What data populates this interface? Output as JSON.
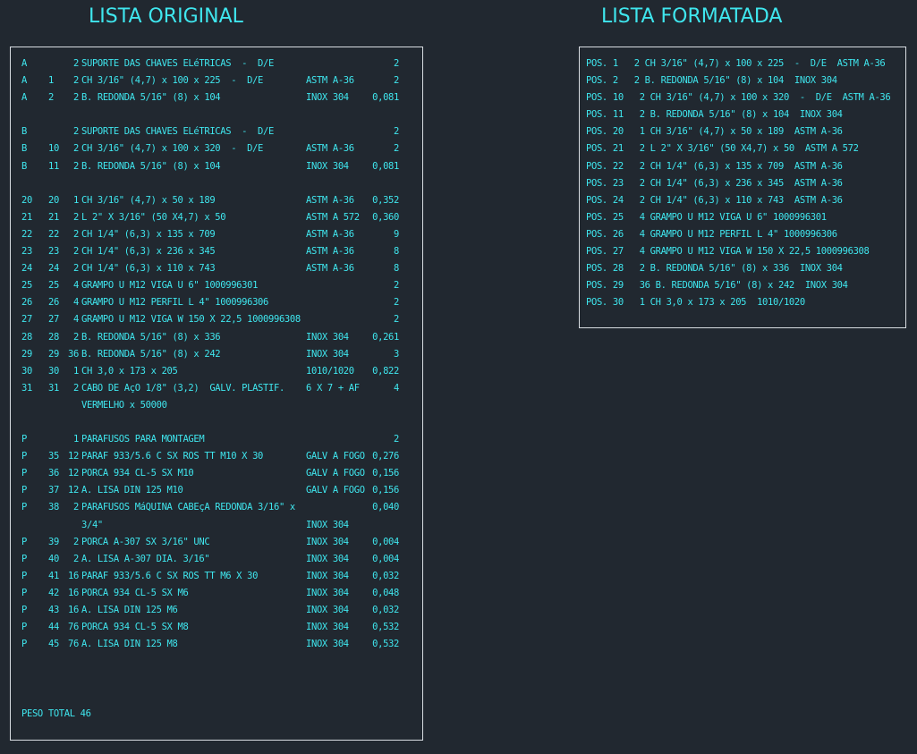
{
  "titles": {
    "left": "LISTA ORIGINAL",
    "right": "LISTA FORMATADA"
  },
  "original": {
    "rows": [
      {
        "group": "A",
        "pos": "",
        "qty": "2",
        "desc": "SUPORTE DAS CHAVES ELéTRICAS  -  D/E",
        "mat": "",
        "wt": "2"
      },
      {
        "group": "A",
        "pos": "1",
        "qty": "2",
        "desc": "CH 3/16\" (4,7) x 100 x 225  -  D/E",
        "mat": "ASTM A-36",
        "wt": "2"
      },
      {
        "group": "A",
        "pos": "2",
        "qty": "2",
        "desc": "B. REDONDA 5/16\" (8) x 104",
        "mat": "INOX 304",
        "wt": "0,081"
      },
      {
        "group": "",
        "pos": "",
        "qty": "",
        "desc": "",
        "mat": "",
        "wt": ""
      },
      {
        "group": "B",
        "pos": "",
        "qty": "2",
        "desc": "SUPORTE DAS CHAVES ELéTRICAS  -  D/E",
        "mat": "",
        "wt": "2"
      },
      {
        "group": "B",
        "pos": "10",
        "qty": "2",
        "desc": "CH 3/16\" (4,7) x 100 x 320  -  D/E",
        "mat": "ASTM A-36",
        "wt": "2"
      },
      {
        "group": "B",
        "pos": "11",
        "qty": "2",
        "desc": "B. REDONDA 5/16\" (8) x 104",
        "mat": "INOX 304",
        "wt": "0,081"
      },
      {
        "group": "",
        "pos": "",
        "qty": "",
        "desc": "",
        "mat": "",
        "wt": ""
      },
      {
        "group": "20",
        "pos": "20",
        "qty": "1",
        "desc": "CH 3/16\" (4,7) x 50 x 189",
        "mat": "ASTM A-36",
        "wt": "0,352"
      },
      {
        "group": "21",
        "pos": "21",
        "qty": "2",
        "desc": "L 2\" X 3/16\" (50 X4,7) x 50",
        "mat": "ASTM A 572",
        "wt": "0,360"
      },
      {
        "group": "22",
        "pos": "22",
        "qty": "2",
        "desc": "CH 1/4\" (6,3) x 135 x 709",
        "mat": "ASTM A-36",
        "wt": "9"
      },
      {
        "group": "23",
        "pos": "23",
        "qty": "2",
        "desc": "CH 1/4\" (6,3) x 236 x 345",
        "mat": "ASTM A-36",
        "wt": "8"
      },
      {
        "group": "24",
        "pos": "24",
        "qty": "2",
        "desc": "CH 1/4\" (6,3) x 110 x 743",
        "mat": "ASTM A-36",
        "wt": "8"
      },
      {
        "group": "25",
        "pos": "25",
        "qty": "4",
        "desc": "GRAMPO U M12 VIGA U 6\" 1000996301",
        "mat": "",
        "wt": "2"
      },
      {
        "group": "26",
        "pos": "26",
        "qty": "4",
        "desc": "GRAMPO U M12 PERFIL L 4\" 1000996306",
        "mat": "",
        "wt": "2"
      },
      {
        "group": "27",
        "pos": "27",
        "qty": "4",
        "desc": "GRAMPO U M12 VIGA W 150 X 22,5 1000996308",
        "mat": "",
        "wt": "2"
      },
      {
        "group": "28",
        "pos": "28",
        "qty": "2",
        "desc": "B. REDONDA 5/16\" (8) x 336",
        "mat": "INOX 304",
        "wt": "0,261"
      },
      {
        "group": "29",
        "pos": "29",
        "qty": "36",
        "desc": "B. REDONDA 5/16\" (8) x 242",
        "mat": "INOX 304",
        "wt": "3"
      },
      {
        "group": "30",
        "pos": "30",
        "qty": "1",
        "desc": "CH 3,0 x 173 x 205",
        "mat": "1010/1020",
        "wt": "0,822"
      },
      {
        "group": "31",
        "pos": "31",
        "qty": "2",
        "desc": "CABO DE AçO 1/8\" (3,2)  GALV. PLASTIF.",
        "mat": "6 X 7 + AF",
        "wt": "4"
      },
      {
        "group": "",
        "pos": "",
        "qty": "",
        "desc": "VERMELHO x 50000",
        "mat": "",
        "wt": ""
      },
      {
        "group": "",
        "pos": "",
        "qty": "",
        "desc": "",
        "mat": "",
        "wt": ""
      },
      {
        "group": "P",
        "pos": "",
        "qty": "1",
        "desc": "PARAFUSOS PARA MONTAGEM",
        "mat": "",
        "wt": "2"
      },
      {
        "group": "P",
        "pos": "35",
        "qty": "12",
        "desc": "PARAF 933/5.6 C SX ROS TT M10 X 30",
        "mat": "GALV A FOGO",
        "wt": "0,276"
      },
      {
        "group": "P",
        "pos": "36",
        "qty": "12",
        "desc": "PORCA 934 CL-5 SX M10",
        "mat": "GALV A FOGO",
        "wt": "0,156"
      },
      {
        "group": "P",
        "pos": "37",
        "qty": "12",
        "desc": "A. LISA DIN 125 M10",
        "mat": "GALV A FOGO",
        "wt": "0,156"
      },
      {
        "group": "P",
        "pos": "38",
        "qty": "2",
        "desc": "PARAFUSOS MáQUINA CABEçA REDONDA 3/16\" x",
        "mat": "",
        "wt": "0,040"
      },
      {
        "group": "",
        "pos": "",
        "qty": "",
        "desc": "3/4\"",
        "mat": "INOX 304",
        "wt": ""
      },
      {
        "group": "P",
        "pos": "39",
        "qty": "2",
        "desc": "PORCA A-307 SX 3/16\" UNC",
        "mat": "INOX 304",
        "wt": "0,004"
      },
      {
        "group": "P",
        "pos": "40",
        "qty": "2",
        "desc": "A. LISA A-307 DIA. 3/16\"",
        "mat": "INOX 304",
        "wt": "0,004"
      },
      {
        "group": "P",
        "pos": "41",
        "qty": "16",
        "desc": "PARAF 933/5.6 C SX ROS TT M6 X 30",
        "mat": "INOX 304",
        "wt": "0,032"
      },
      {
        "group": "P",
        "pos": "42",
        "qty": "16",
        "desc": "PORCA 934 CL-5 SX M6",
        "mat": "INOX 304",
        "wt": "0,048"
      },
      {
        "group": "P",
        "pos": "43",
        "qty": "16",
        "desc": "A. LISA DIN 125 M6",
        "mat": "INOX 304",
        "wt": "0,032"
      },
      {
        "group": "P",
        "pos": "44",
        "qty": "76",
        "desc": "PORCA 934 CL-5 SX M8",
        "mat": "INOX 304",
        "wt": "0,532"
      },
      {
        "group": "P",
        "pos": "45",
        "qty": "76",
        "desc": "A. LISA DIN 125 M8",
        "mat": "INOX 304",
        "wt": "0,532"
      }
    ],
    "total": "PESO TOTAL 46"
  },
  "formatted": {
    "rows": [
      "POS. 1   2 CH 3/16\" (4,7) x 100 x 225  -  D/E  ASTM A-36",
      "POS. 2   2 B. REDONDA 5/16\" (8) x 104  INOX 304",
      "POS. 10   2 CH 3/16\" (4,7) x 100 x 320  -  D/E  ASTM A-36",
      "POS. 11   2 B. REDONDA 5/16\" (8) x 104  INOX 304",
      "POS. 20   1 CH 3/16\" (4,7) x 50 x 189  ASTM A-36",
      "POS. 21   2 L 2\" X 3/16\" (50 X4,7) x 50  ASTM A 572",
      "POS. 22   2 CH 1/4\" (6,3) x 135 x 709  ASTM A-36",
      "POS. 23   2 CH 1/4\" (6,3) x 236 x 345  ASTM A-36",
      "POS. 24   2 CH 1/4\" (6,3) x 110 x 743  ASTM A-36",
      "POS. 25   4 GRAMPO U M12 VIGA U 6\" 1000996301",
      "POS. 26   4 GRAMPO U M12 PERFIL L 4\" 1000996306",
      "POS. 27   4 GRAMPO U M12 VIGA W 150 X 22,5 1000996308",
      "POS. 28   2 B. REDONDA 5/16\" (8) x 336  INOX 304",
      "POS. 29   36 B. REDONDA 5/16\" (8) x 242  INOX 304",
      "POS. 30   1 CH 3,0 x 173 x 205  1010/1020"
    ]
  },
  "colors": {
    "background": "#212830",
    "text": "#3fe6ee",
    "frame": "#d8dde2"
  }
}
